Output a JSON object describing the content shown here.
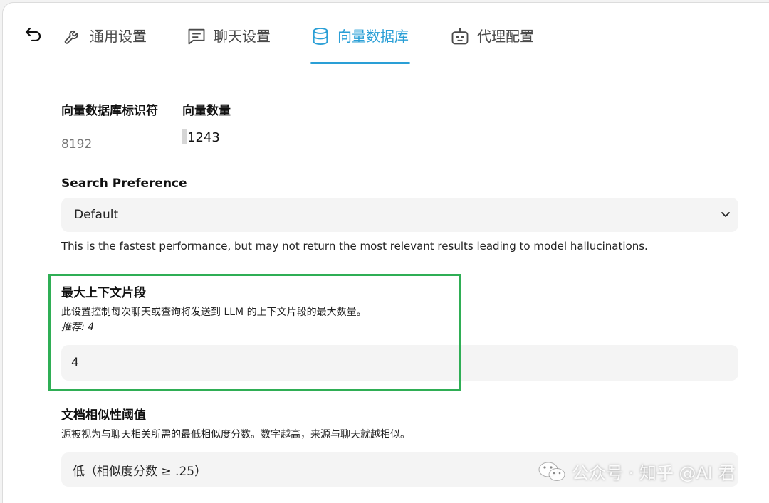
{
  "tabs": [
    {
      "label": "通用设置",
      "icon": "wrench-icon"
    },
    {
      "label": "聊天设置",
      "icon": "chat-icon"
    },
    {
      "label": "向量数据库",
      "icon": "database-icon",
      "active": true
    },
    {
      "label": "代理配置",
      "icon": "robot-icon"
    }
  ],
  "info": {
    "identifier_label": "向量数据库标识符",
    "identifier_value": "8192",
    "count_label": "向量数量",
    "count_value": "1243"
  },
  "search": {
    "label": "Search Preference",
    "value": "Default",
    "hint": "This is the fastest performance, but may not return the most relevant results leading to model hallucinations."
  },
  "max_snippets": {
    "label": "最大上下文片段",
    "desc": "此设置控制每次聊天或查询将发送到 LLM 的上下文片段的最大数量。",
    "recommend": "推荐: 4",
    "value": "4"
  },
  "similarity": {
    "label": "文档相似性阈值",
    "desc": "源被视为与聊天相关所需的最低相似度分数。数字越高，来源与聊天就越相似。",
    "value": "低（相似度分数 ≥ .25）"
  },
  "watermark": {
    "text": "公众号 · 知乎 @AI 君"
  },
  "colors": {
    "accent": "#2a9fd6",
    "highlight": "#2fae55"
  }
}
